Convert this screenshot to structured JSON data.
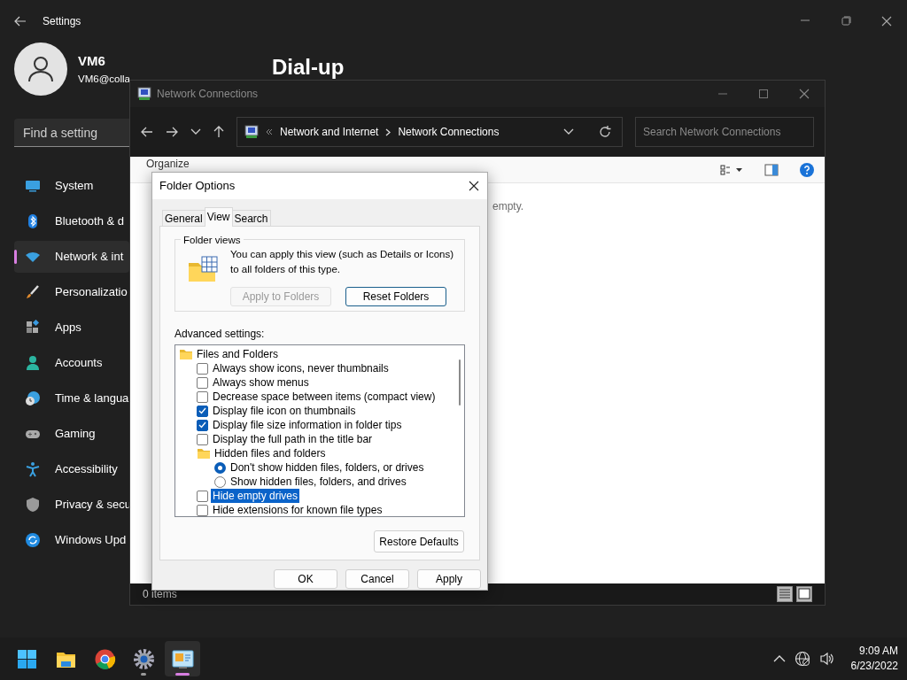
{
  "settings": {
    "title": "Settings",
    "user": {
      "name": "VM6",
      "email": "VM6@colla"
    },
    "search": {
      "placeholder": "Find a setting"
    },
    "nav": [
      {
        "label": "System",
        "selected": false
      },
      {
        "label": "Bluetooth & d",
        "selected": false
      },
      {
        "label": "Network & int",
        "selected": true
      },
      {
        "label": "Personalizatio",
        "selected": false
      },
      {
        "label": "Apps",
        "selected": false
      },
      {
        "label": "Accounts",
        "selected": false
      },
      {
        "label": "Time & langua",
        "selected": false
      },
      {
        "label": "Gaming",
        "selected": false
      },
      {
        "label": "Accessibility",
        "selected": false
      },
      {
        "label": "Privacy & secu",
        "selected": false
      },
      {
        "label": "Windows Upd",
        "selected": false
      }
    ],
    "page_title": "Dial-up"
  },
  "explorer": {
    "title": "Network Connections",
    "breadcrumb": [
      "Network and Internet",
      "Network Connections"
    ],
    "search": {
      "placeholder": "Search Network Connections"
    },
    "organize": "Organize",
    "message": "empty.",
    "status": "0 items"
  },
  "dialog": {
    "title": "Folder Options",
    "tabs": [
      {
        "label": "General",
        "selected": false
      },
      {
        "label": "View",
        "selected": true
      },
      {
        "label": "Search",
        "selected": false
      }
    ],
    "folder_views": {
      "legend": "Folder views",
      "text": "You can apply this view (such as Details or Icons) to all folders of this type.",
      "buttons": [
        {
          "label": "Apply to Folders",
          "disabled": true,
          "focused": false
        },
        {
          "label": "Reset Folders",
          "disabled": false,
          "focused": true
        }
      ]
    },
    "advanced_label": "Advanced settings:",
    "tree": [
      {
        "kind": "folder",
        "label": "Files and Folders",
        "selected": false,
        "children": [
          {
            "kind": "checkbox",
            "label": "Always show icons, never thumbnails",
            "checked": false,
            "selected": false
          },
          {
            "kind": "checkbox",
            "label": "Always show menus",
            "checked": false,
            "selected": false
          },
          {
            "kind": "checkbox",
            "label": "Decrease space between items (compact view)",
            "checked": false,
            "selected": false
          },
          {
            "kind": "checkbox",
            "label": "Display file icon on thumbnails",
            "checked": true,
            "selected": false
          },
          {
            "kind": "checkbox",
            "label": "Display file size information in folder tips",
            "checked": true,
            "selected": false
          },
          {
            "kind": "checkbox",
            "label": "Display the full path in the title bar",
            "checked": false,
            "selected": false
          },
          {
            "kind": "folder",
            "label": "Hidden files and folders",
            "selected": false,
            "children": [
              {
                "kind": "radio",
                "label": "Don't show hidden files, folders, or drives",
                "checked": true,
                "selected": false
              },
              {
                "kind": "radio",
                "label": "Show hidden files, folders, and drives",
                "checked": false,
                "selected": false
              }
            ]
          },
          {
            "kind": "checkbox",
            "label": "Hide empty drives",
            "checked": false,
            "selected": true
          },
          {
            "kind": "checkbox",
            "label": "Hide extensions for known file types",
            "checked": false,
            "selected": false
          }
        ]
      }
    ],
    "restore_button": "Restore Defaults",
    "buttons": [
      "OK",
      "Cancel",
      "Apply"
    ]
  },
  "taskbar": {
    "apps": [
      {
        "running": false,
        "active": false
      },
      {
        "running": false,
        "active": false
      },
      {
        "running": false,
        "active": false
      },
      {
        "running": true,
        "active": false
      },
      {
        "running": true,
        "active": true
      }
    ],
    "time": "9:09 AM",
    "date": "6/23/2022"
  }
}
